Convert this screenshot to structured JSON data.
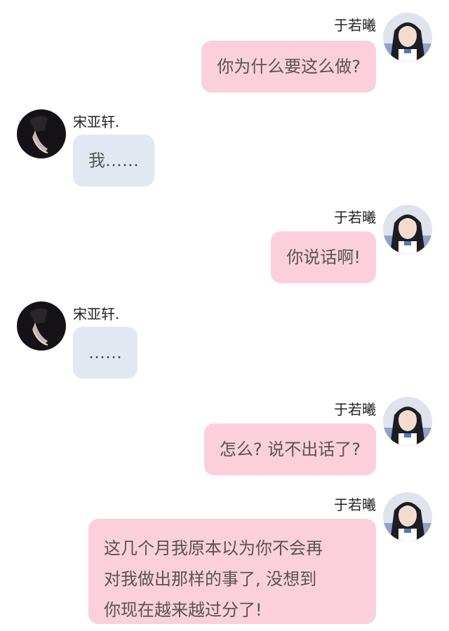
{
  "chat": {
    "messages": [
      {
        "side": "right",
        "sender": "于若曦",
        "lines": [
          "你为什么要这么做?"
        ],
        "avatar": "girl-avatar"
      },
      {
        "side": "left",
        "sender": "宋亚轩.",
        "lines": [
          "我……"
        ],
        "avatar": "boy-avatar"
      },
      {
        "side": "right",
        "sender": "于若曦",
        "lines": [
          "你说话啊!"
        ],
        "avatar": "girl-avatar"
      },
      {
        "side": "left",
        "sender": "宋亚轩.",
        "lines": [
          "……"
        ],
        "avatar": "boy-avatar"
      },
      {
        "side": "right",
        "sender": "于若曦",
        "lines": [
          "怎么? 说不出话了?"
        ],
        "avatar": "girl-avatar"
      },
      {
        "side": "right",
        "sender": "于若曦",
        "lines": [
          "这几个月我原本以为你不会再",
          "对我做出那样的事了, 没想到",
          "你现在越来越过分了!"
        ],
        "avatar": "girl-avatar"
      }
    ]
  },
  "colors": {
    "right_bubble": "#fbd0da",
    "left_bubble": "#e2e8f1",
    "text": "#555555",
    "name": "#222222"
  }
}
